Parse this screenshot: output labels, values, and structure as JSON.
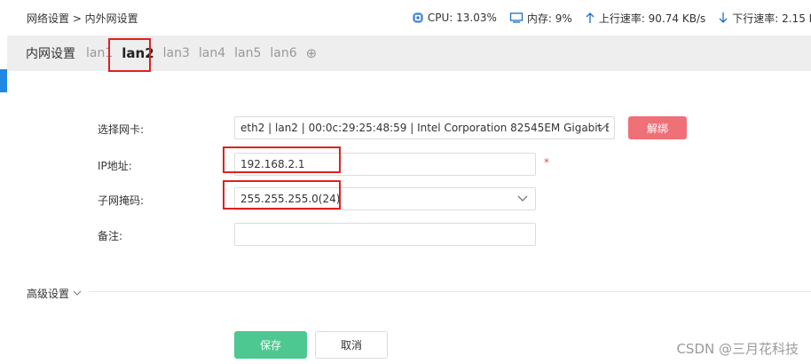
{
  "breadcrumb": "网络设置 > 内外网设置",
  "stats": {
    "cpu": "CPU: 13.03%",
    "memory": "内存: 9%",
    "upload": "上行速率: 90.74 KB/s",
    "download": "下行速率: 2.15 M"
  },
  "tabs": {
    "title": "内网设置",
    "items": [
      "lan1",
      "lan2",
      "lan3",
      "lan4",
      "lan5",
      "lan6"
    ],
    "active": "lan2",
    "add_symbol": "⊕"
  },
  "form": {
    "nic_label": "选择网卡:",
    "nic_value": "eth2 | lan2 | 00:0c:29:25:48:59 | Intel Corporation 82545EM Gigabit Eth",
    "unbind_label": "解绑",
    "ip_label": "IP地址:",
    "ip_value": "192.168.2.1",
    "required_mark": "*",
    "mask_label": "子网掩码:",
    "mask_value": "255.255.255.0(24)",
    "note_label": "备注:",
    "note_value": ""
  },
  "advanced_label": "高级设置",
  "buttons": {
    "save": "保存",
    "cancel": "取消"
  },
  "watermark": "CSDN @三月花科技",
  "colors": {
    "accent_blue": "#1e88e5",
    "unbind_red": "#f07077",
    "save_green": "#4dc891",
    "highlight_red": "#e02020",
    "icon_blue": "#1e6fbf"
  }
}
